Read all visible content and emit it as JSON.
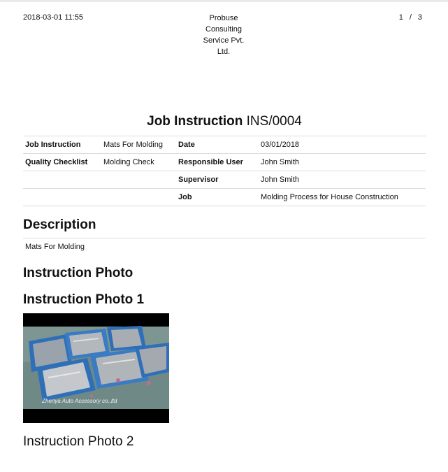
{
  "header": {
    "datetime": "2018-03-01 11:55",
    "company_lines": [
      "Probuse",
      "Consulting",
      "Service Pvt.",
      "Ltd."
    ],
    "page_current": "1",
    "page_separator": "/",
    "page_total": "3"
  },
  "title": {
    "label": "Job Instruction",
    "number": "INS/0004"
  },
  "info_table": {
    "rows": [
      [
        "Job Instruction",
        "Mats For Molding",
        "Date",
        "03/01/2018"
      ],
      [
        "Quality Checklist",
        "Molding Check",
        "Responsible User",
        "John Smith"
      ],
      [
        "",
        "",
        "Supervisor",
        "John Smith"
      ],
      [
        "",
        "",
        "Job",
        "Molding Process for House Construction"
      ]
    ]
  },
  "description": {
    "heading": "Description",
    "text": "Mats For Molding"
  },
  "photos": {
    "heading": "Instruction Photo",
    "photo1_heading": "Instruction Photo 1",
    "photo1_caption": "Zhenya Auto Accessory co.,ltd",
    "photo2_heading": "Instruction Photo 2"
  }
}
